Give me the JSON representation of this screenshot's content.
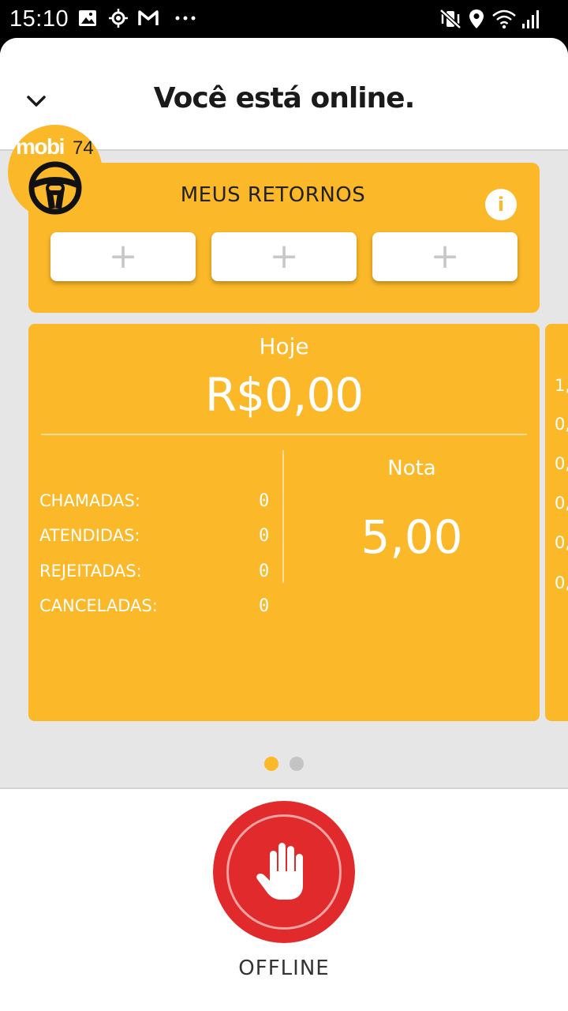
{
  "status_bar": {
    "time": "15:10",
    "left_icons": [
      "gallery-icon",
      "location-target-icon",
      "gmail-icon",
      "more-dots-icon"
    ],
    "right_icons": [
      "mute-vibrate-icon",
      "location-pin-icon",
      "wifi-icon",
      "signal-icon"
    ]
  },
  "header": {
    "title": "Você está online.",
    "collapse_icon": "chevron-down-icon"
  },
  "logo": {
    "brand": "mobi",
    "number": "74"
  },
  "returns": {
    "title": "MEUS RETORNOS",
    "info_label": "i",
    "slots": [
      "+",
      "+",
      "+"
    ]
  },
  "today": {
    "label": "Hoje",
    "amount": "R$0,00",
    "stats": [
      {
        "label": "CHAMADAS:",
        "value": "0"
      },
      {
        "label": "ATENDIDAS:",
        "value": "0"
      },
      {
        "label": "REJEITADAS:",
        "value": "0"
      },
      {
        "label": "CANCELADAS:",
        "value": "0"
      }
    ],
    "rating_label": "Nota",
    "rating_value": "5,00"
  },
  "next_card_peek": [
    "1,",
    "0,",
    "0,",
    "0,",
    "0,",
    "0,"
  ],
  "pager": {
    "active_color": "#fbb829",
    "inactive_color": "#c4c4c4",
    "count": 2,
    "active_index": 0
  },
  "offline_button": {
    "label": "OFFLINE",
    "icon": "hand-stop-icon",
    "color": "#e12a2b"
  },
  "colors": {
    "accent": "#fbb829",
    "danger": "#e12a2b"
  }
}
